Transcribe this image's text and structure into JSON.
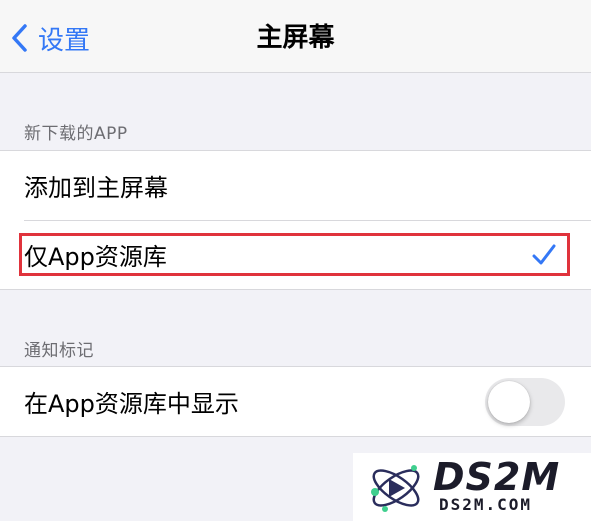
{
  "nav": {
    "back_label": "设置",
    "title": "主屏幕"
  },
  "new_apps": {
    "header": "新下载的APP",
    "options": [
      {
        "label": "添加到主屏幕",
        "selected": false
      },
      {
        "label": "仅App资源库",
        "selected": true
      }
    ]
  },
  "badges": {
    "header": "通知标记",
    "show_in_library": {
      "label": "在App资源库中显示",
      "enabled": false
    }
  },
  "watermark": {
    "brand": "DS2M",
    "domain": "DS2M.COM"
  },
  "colors": {
    "accent": "#3478f6",
    "highlight_box": "#e0333c"
  }
}
